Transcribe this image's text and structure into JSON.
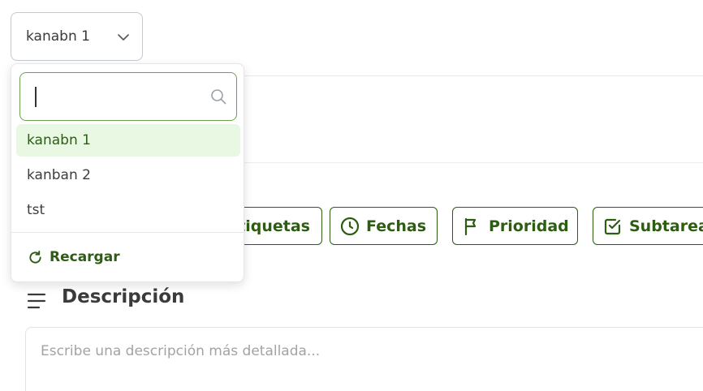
{
  "board_select": {
    "value": "kanabn 1",
    "icon": "chevron-down-icon"
  },
  "dropdown": {
    "search": {
      "value": "",
      "placeholder": "",
      "icon": "search-icon"
    },
    "options": [
      {
        "label": "kanabn 1",
        "selected": true
      },
      {
        "label": "kanban 2",
        "selected": false
      },
      {
        "label": "tst",
        "selected": false
      }
    ],
    "reload_label": "Recargar",
    "reload_icon": "refresh-icon"
  },
  "actions": {
    "etiquetas": "Etiquetas",
    "fechas": "Fechas",
    "prioridad": "Prioridad",
    "subtareas": "Subtareas"
  },
  "description": {
    "title": "Descripción",
    "placeholder": "Escribe una descripción más detallada..."
  },
  "colors": {
    "accent": "#2c5d12",
    "selected_bg": "#e9f8e2",
    "search_border": "#6fa24a"
  }
}
